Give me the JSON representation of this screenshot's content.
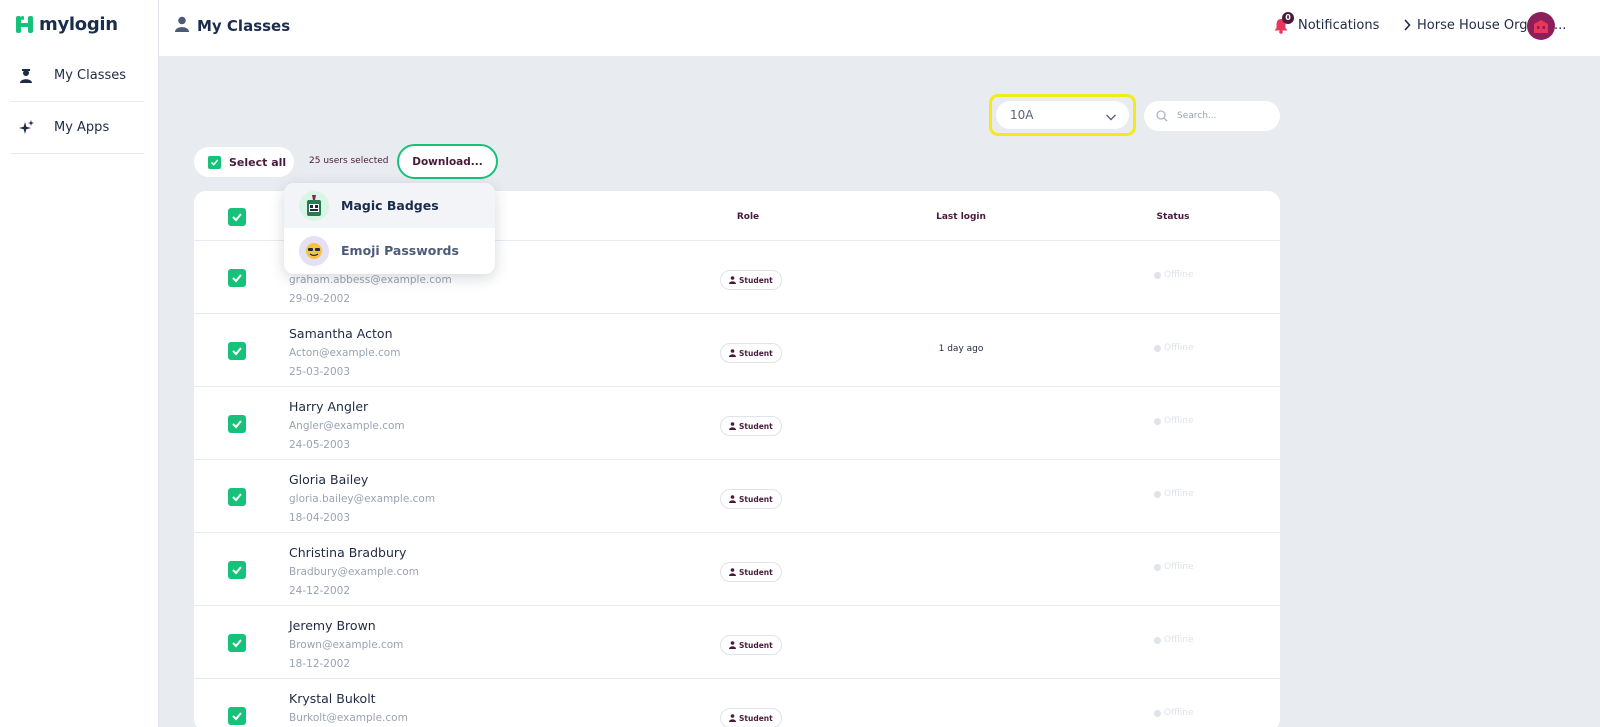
{
  "app": {
    "logo_text": "mylogin"
  },
  "sidebar": {
    "items": [
      {
        "label": "My Classes"
      },
      {
        "label": "My Apps"
      }
    ]
  },
  "header": {
    "title": "My Classes",
    "notifications_label": "Notifications",
    "notifications_count": "0",
    "org_label": "Horse House Organis..."
  },
  "filters": {
    "class_value": "10A",
    "search_placeholder": "Search..."
  },
  "toolbar": {
    "select_all_label": "Select all",
    "users_selected": "25 users selected",
    "download_label": "Download..."
  },
  "download_menu": {
    "items": [
      {
        "label": "Magic Badges"
      },
      {
        "label": "Emoji Passwords"
      }
    ]
  },
  "table": {
    "headers": {
      "role": "Role",
      "last_login": "Last login",
      "status": "Status"
    },
    "rows": [
      {
        "name": "",
        "email": "graham.abbess@example.com",
        "dob": "29-09-2002",
        "role": "Student",
        "last_login": "",
        "status": "Offline"
      },
      {
        "name": "Samantha Acton",
        "email": "Acton@example.com",
        "dob": "25-03-2003",
        "role": "Student",
        "last_login": "1 day ago",
        "status": "Offline"
      },
      {
        "name": "Harry Angler",
        "email": "Angler@example.com",
        "dob": "24-05-2003",
        "role": "Student",
        "last_login": "",
        "status": "Offline"
      },
      {
        "name": "Gloria Bailey",
        "email": "gloria.bailey@example.com",
        "dob": "18-04-2003",
        "role": "Student",
        "last_login": "",
        "status": "Offline"
      },
      {
        "name": "Christina Bradbury",
        "email": "Bradbury@example.com",
        "dob": "24-12-2002",
        "role": "Student",
        "last_login": "",
        "status": "Offline"
      },
      {
        "name": "Jeremy Brown",
        "email": "Brown@example.com",
        "dob": "18-12-2002",
        "role": "Student",
        "last_login": "",
        "status": "Offline"
      },
      {
        "name": "Krystal Bukolt",
        "email": "Burkolt@example.com",
        "dob": "",
        "role": "Student",
        "last_login": "",
        "status": "Offline"
      }
    ]
  },
  "colors": {
    "accent": "#16c27a",
    "brand_dark": "#4a1a3c",
    "highlight": "#f2ea1a",
    "notification": "#e8365d",
    "org_avatar": "#8b1f5c"
  },
  "icons": {
    "logo": "logo-icon",
    "classes": "teacher-icon",
    "apps": "sparkles-icon",
    "title": "user-icon",
    "bell": "bell-icon",
    "org": "chevron-right-icon",
    "select": "chevron-down-icon",
    "search": "search-icon",
    "checkbox": "check-icon",
    "role": "person-icon",
    "status": "dot-icon"
  }
}
